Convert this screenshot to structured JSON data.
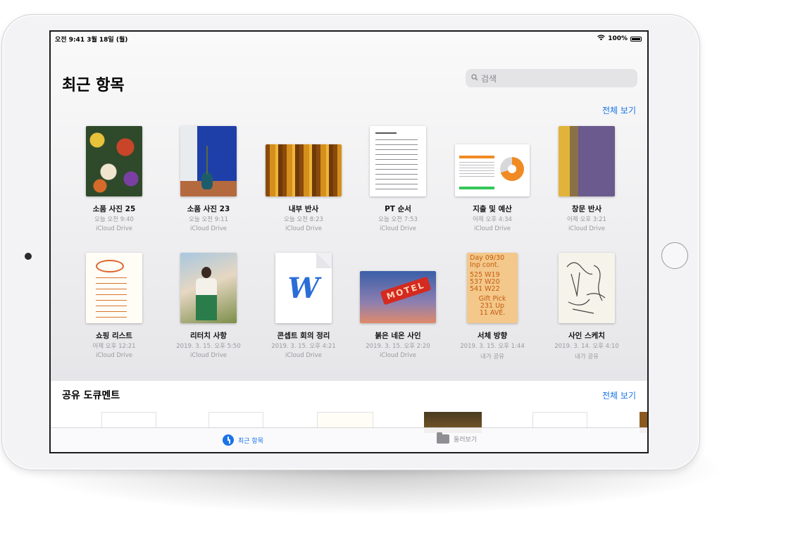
{
  "status_bar": {
    "time_date": "오전 9:41  3월 18일 (월)",
    "battery": "100%"
  },
  "header": {
    "title": "최근 항목",
    "search_placeholder": "검색",
    "see_all": "전체 보기"
  },
  "recent_items": [
    {
      "name": "소품 사진 25",
      "date": "오늘 오전 9:40",
      "location": "iCloud Drive"
    },
    {
      "name": "소품 사진 23",
      "date": "오늘 오전 9:11",
      "location": "iCloud Drive"
    },
    {
      "name": "내부 반사",
      "date": "오늘 오전 8:23",
      "location": "iCloud Drive"
    },
    {
      "name": "PT 순서",
      "date": "오늘 오전 7:53",
      "location": "iCloud Drive"
    },
    {
      "name": "지출 및 예산",
      "date": "어제 오후 4:34",
      "location": "iCloud Drive"
    },
    {
      "name": "창문 반사",
      "date": "어제 오후 3:21",
      "location": "iCloud Drive"
    },
    {
      "name": "쇼핑 리스트",
      "date": "어제 오후 12:21",
      "location": "iCloud Drive"
    },
    {
      "name": "리터치 사항",
      "date": "2019. 3. 15. 오후 5:50",
      "location": "iCloud Drive"
    },
    {
      "name": "콘셉트 회의 정리",
      "date": "2019. 3. 15. 오후 4:21",
      "location": "iCloud Drive"
    },
    {
      "name": "붉은 네온 사인",
      "date": "2019. 3. 15. 오후 2:20",
      "location": "iCloud Drive"
    },
    {
      "name": "서체 방향",
      "date": "2019. 3. 15. 오후 1:44",
      "location": "내가 공유"
    },
    {
      "name": "사인 스케치",
      "date": "2019. 3. 14. 오후 4:10",
      "location": "내가 공유"
    }
  ],
  "thumb_text": {
    "word_letter": "W",
    "motel": "MOTEL",
    "type_lines": [
      "Day 09/30",
      "Inp cont.",
      "525 W19",
      "537 W20",
      "541 W22",
      "Gift Pick",
      "231 Up",
      "11 AVE."
    ]
  },
  "shared_section": {
    "title": "공유 도큐멘트",
    "see_all": "전체 보기"
  },
  "tab_bar": {
    "recents": "최근 항목",
    "browse": "둘러보기"
  },
  "colors": {
    "accent": "#1a73e8"
  }
}
